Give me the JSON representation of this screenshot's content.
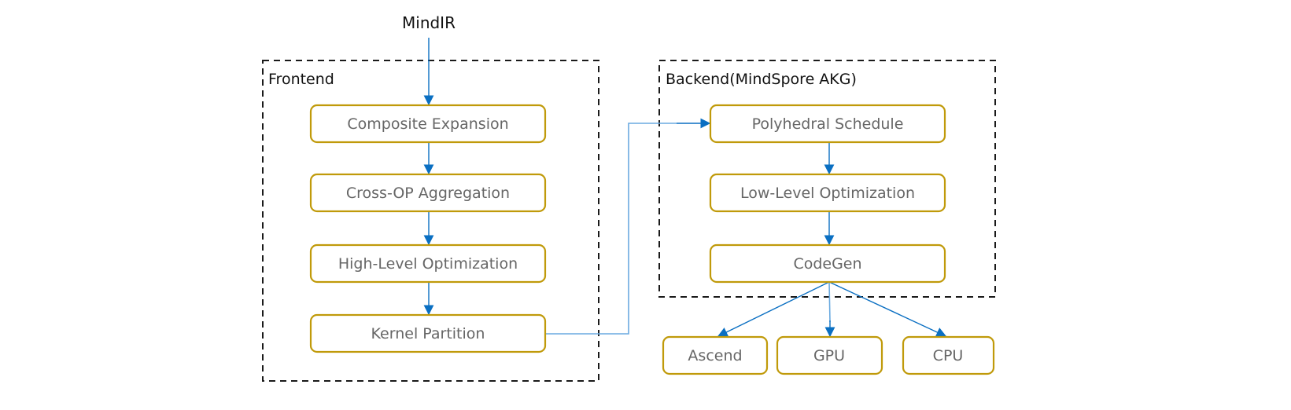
{
  "diagram": {
    "input_label": "MindIR",
    "colors": {
      "node_border": "#C09A0A",
      "node_text": "#666666",
      "edge": "#0A6FC2",
      "edge_light": "#6AAAE0",
      "group_border": "#1a1a1a"
    },
    "groups": [
      {
        "id": "frontend",
        "label": "Frontend",
        "nodes": [
          {
            "id": "composite-expansion",
            "label": "Composite Expansion"
          },
          {
            "id": "cross-op-aggregation",
            "label": "Cross-OP Aggregation"
          },
          {
            "id": "high-level-optimization",
            "label": "High-Level Optimization"
          },
          {
            "id": "kernel-partition",
            "label": "Kernel Partition"
          }
        ]
      },
      {
        "id": "backend",
        "label": "Backend(MindSpore AKG)",
        "nodes": [
          {
            "id": "polyhedral-schedule",
            "label": "Polyhedral Schedule"
          },
          {
            "id": "low-level-optimization",
            "label": "Low-Level Optimization"
          },
          {
            "id": "codegen",
            "label": "CodeGen"
          }
        ]
      }
    ],
    "targets": [
      {
        "id": "ascend",
        "label": "Ascend"
      },
      {
        "id": "gpu",
        "label": "GPU"
      },
      {
        "id": "cpu",
        "label": "CPU"
      }
    ],
    "edges": [
      {
        "from": "mindir",
        "to": "composite-expansion"
      },
      {
        "from": "composite-expansion",
        "to": "cross-op-aggregation"
      },
      {
        "from": "cross-op-aggregation",
        "to": "high-level-optimization"
      },
      {
        "from": "high-level-optimization",
        "to": "kernel-partition"
      },
      {
        "from": "kernel-partition",
        "to": "polyhedral-schedule"
      },
      {
        "from": "polyhedral-schedule",
        "to": "low-level-optimization"
      },
      {
        "from": "low-level-optimization",
        "to": "codegen"
      },
      {
        "from": "codegen",
        "to": "ascend"
      },
      {
        "from": "codegen",
        "to": "gpu"
      },
      {
        "from": "codegen",
        "to": "cpu"
      }
    ]
  }
}
